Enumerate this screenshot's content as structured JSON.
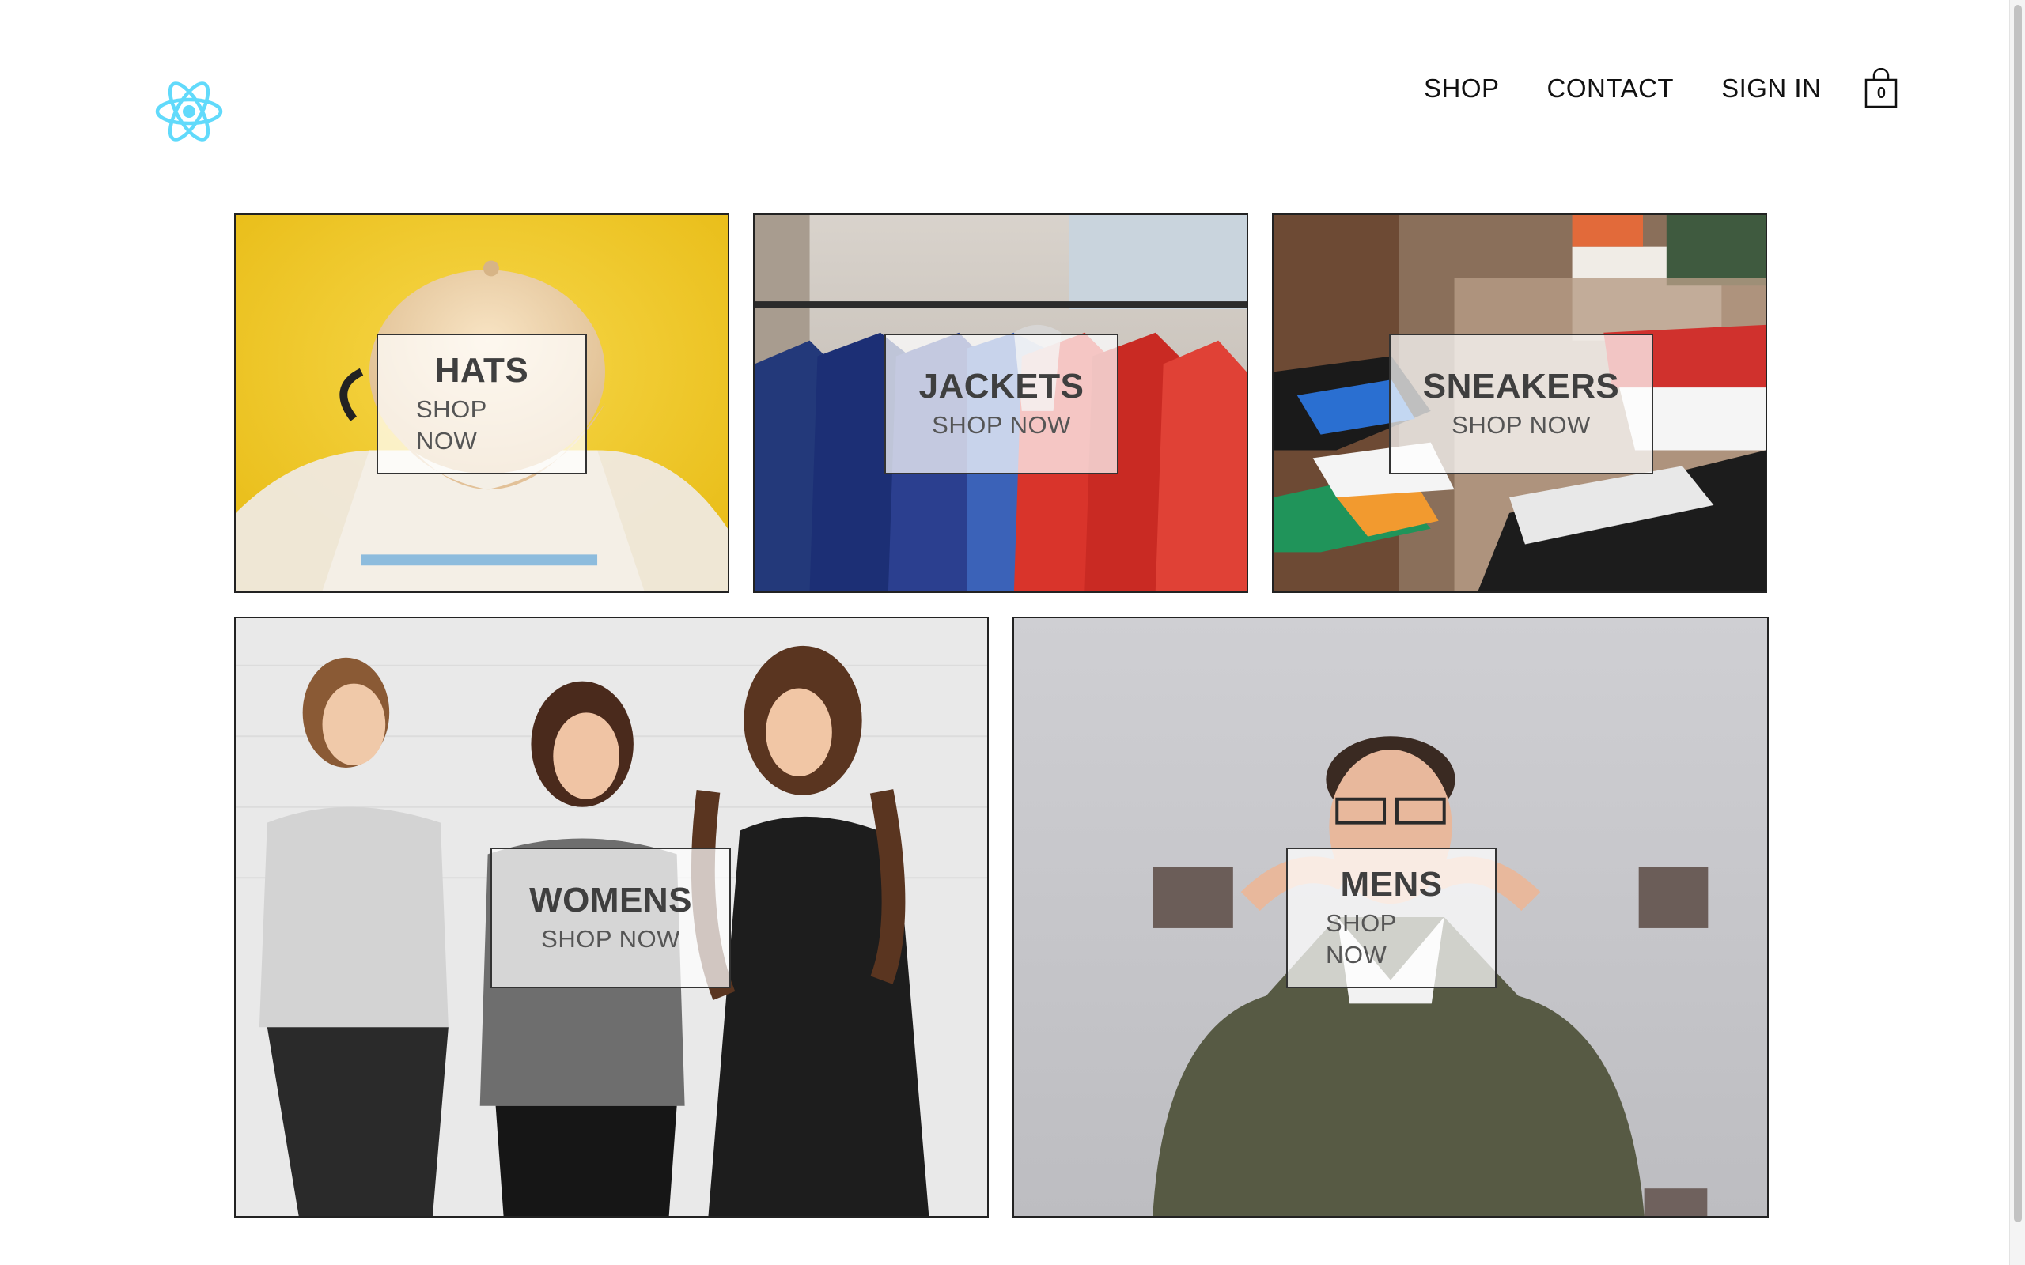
{
  "header": {
    "logo_icon": "react-atom-icon",
    "logo_color": "#61dafb",
    "nav": {
      "shop": "SHOP",
      "contact": "CONTACT",
      "sign_in": "SIGN IN"
    },
    "cart": {
      "icon": "shopping-bag-icon",
      "count": "0"
    }
  },
  "directory": [
    {
      "id": "hats",
      "title": "HATS",
      "subtitle": "SHOP NOW"
    },
    {
      "id": "jackets",
      "title": "JACKETS",
      "subtitle": "SHOP NOW"
    },
    {
      "id": "sneakers",
      "title": "SNEAKERS",
      "subtitle": "SHOP NOW"
    },
    {
      "id": "womens",
      "title": "WOMENS",
      "subtitle": "SHOP NOW"
    },
    {
      "id": "mens",
      "title": "MENS",
      "subtitle": "SHOP NOW"
    }
  ]
}
